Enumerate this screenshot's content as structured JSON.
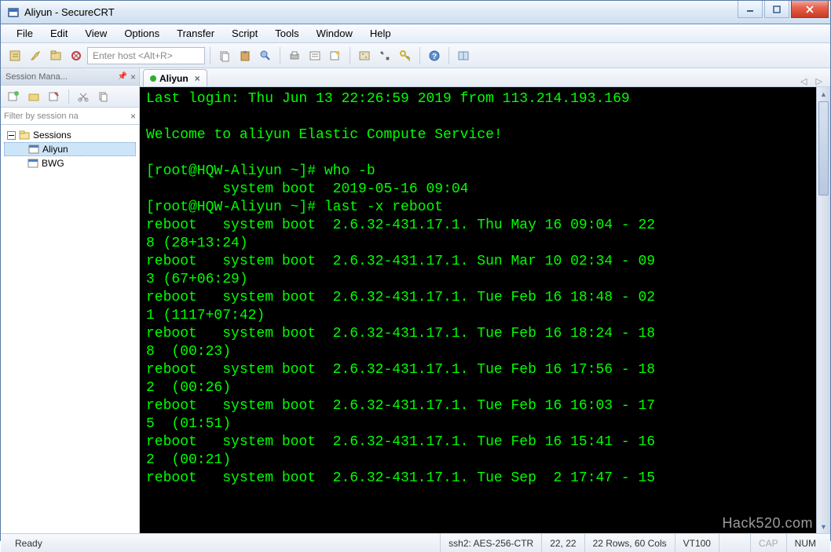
{
  "window": {
    "title": "Aliyun - SecureCRT"
  },
  "menu": {
    "items": [
      "File",
      "Edit",
      "View",
      "Options",
      "Transfer",
      "Script",
      "Tools",
      "Window",
      "Help"
    ]
  },
  "toolbar": {
    "host_placeholder": "Enter host <Alt+R>"
  },
  "sidebar": {
    "title": "Session Mana...",
    "filter_placeholder": "Filter by session na",
    "root": "Sessions",
    "items": [
      {
        "label": "Aliyun",
        "selected": true
      },
      {
        "label": "BWG",
        "selected": false
      }
    ]
  },
  "tabs": [
    {
      "label": "Aliyun",
      "active": true
    }
  ],
  "terminal_lines": [
    "Last login: Thu Jun 13 22:26:59 2019 from 113.214.193.169",
    "",
    "Welcome to aliyun Elastic Compute Service!",
    "",
    "[root@HQW-Aliyun ~]# who -b",
    "         system boot  2019-05-16 09:04",
    "[root@HQW-Aliyun ~]# last -x reboot",
    "reboot   system boot  2.6.32-431.17.1. Thu May 16 09:04 - 22",
    "8 (28+13:24)",
    "reboot   system boot  2.6.32-431.17.1. Sun Mar 10 02:34 - 09",
    "3 (67+06:29)",
    "reboot   system boot  2.6.32-431.17.1. Tue Feb 16 18:48 - 02",
    "1 (1117+07:42)",
    "reboot   system boot  2.6.32-431.17.1. Tue Feb 16 18:24 - 18",
    "8  (00:23)",
    "reboot   system boot  2.6.32-431.17.1. Tue Feb 16 17:56 - 18",
    "2  (00:26)",
    "reboot   system boot  2.6.32-431.17.1. Tue Feb 16 16:03 - 17",
    "5  (01:51)",
    "reboot   system boot  2.6.32-431.17.1. Tue Feb 16 15:41 - 16",
    "2  (00:21)",
    "reboot   system boot  2.6.32-431.17.1. Tue Sep  2 17:47 - 15"
  ],
  "statusbar": {
    "ready": "Ready",
    "cipher": "ssh2: AES-256-CTR",
    "cursor": "22,  22",
    "size": "22 Rows, 60 Cols",
    "emulation": "VT100",
    "cap": "CAP",
    "num": "NUM"
  },
  "watermark": "Hack520.com"
}
